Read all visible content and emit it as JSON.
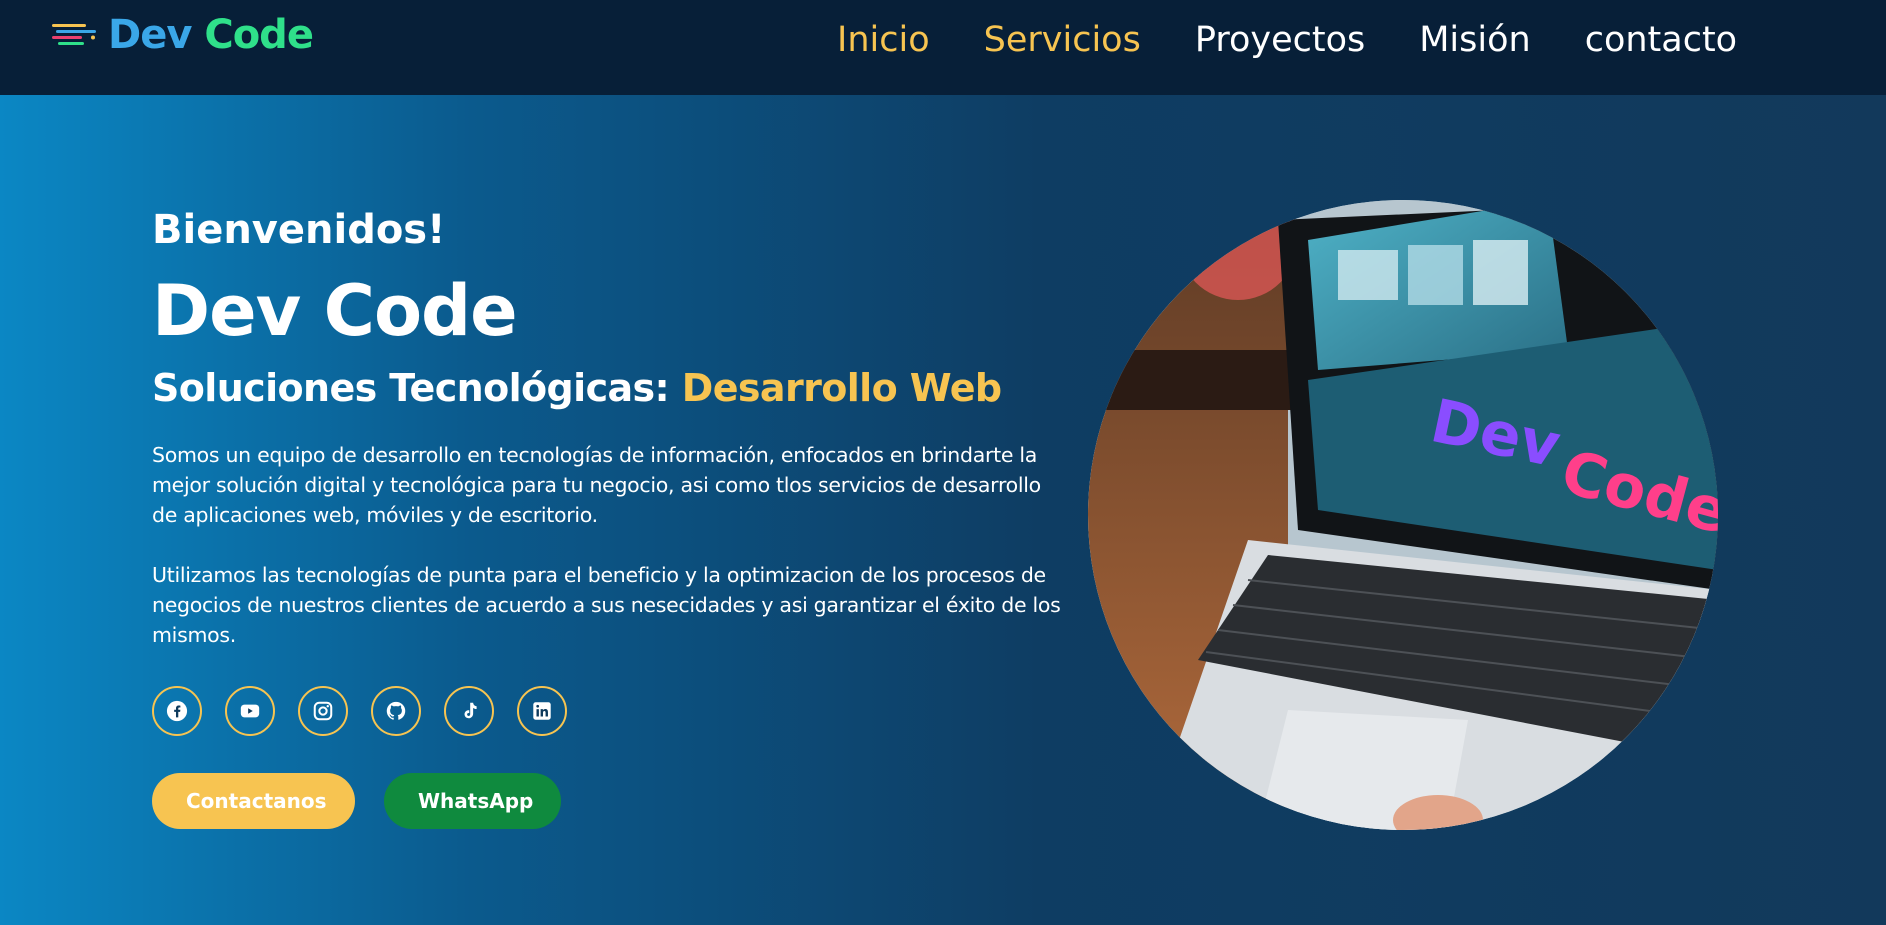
{
  "header": {
    "logo": {
      "dev": "Dev",
      "code": "Code"
    },
    "nav": [
      {
        "label": "Inicio",
        "active": true
      },
      {
        "label": "Servicios",
        "active": true
      },
      {
        "label": "Proyectos",
        "active": false
      },
      {
        "label": "Misión",
        "active": false
      },
      {
        "label": "contacto",
        "active": false
      }
    ]
  },
  "hero": {
    "greeting": "Bienvenidos!",
    "title": "Dev Code",
    "subtitle_main": "Soluciones Tecnológicas: ",
    "subtitle_accent": "Desarrollo Web",
    "paragraphs": [
      "Somos un equipo de desarrollo en tecnologías de información, enfocados en brindarte la mejor solución digital y tecnológica para tu negocio, asi como tlos servicios de desarrollo de aplicaciones web, móviles y de escritorio.",
      "Utilizamos las tecnologías de punta para el beneficio y la optimizacion de los procesos de negocios de nuestros clientes de acuerdo a sus nesecidades y asi garantizar el éxito de los mismos."
    ],
    "socials": [
      "facebook-icon",
      "youtube-icon",
      "instagram-icon",
      "github-icon",
      "tiktok-icon",
      "linkedin-icon"
    ],
    "buttons": {
      "contact": "Contactanos",
      "whatsapp": "WhatsApp"
    },
    "image_text": {
      "dev": "Dev",
      "code": "Code"
    }
  },
  "colors": {
    "accent": "#f7c451",
    "nav_bg": "#071f38",
    "whatsapp": "#0f8a3e",
    "logo_dev": "#3aa7e8",
    "logo_code": "#2fe08a"
  }
}
